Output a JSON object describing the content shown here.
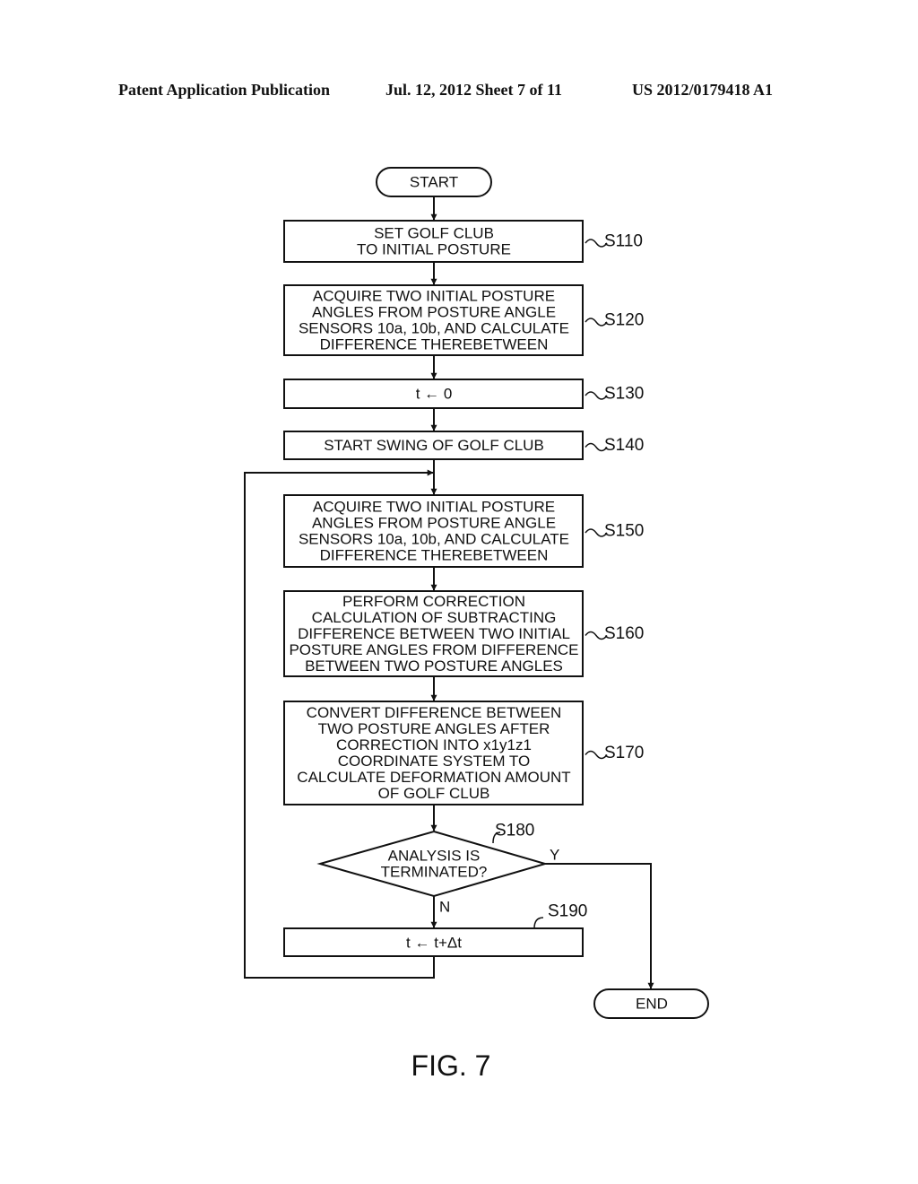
{
  "header": {
    "left": "Patent Application Publication",
    "date_sheet": "Jul. 12, 2012   Sheet 7 of 11",
    "number": "US 2012/0179418 A1"
  },
  "flowchart": {
    "start": "START",
    "end": "END",
    "steps": [
      {
        "id": "S110",
        "lines": [
          "SET GOLF CLUB",
          "TO INITIAL POSTURE"
        ]
      },
      {
        "id": "S120",
        "lines": [
          "ACQUIRE TWO INITIAL POSTURE",
          "ANGLES FROM POSTURE ANGLE",
          "SENSORS 10a, 10b, AND CALCULATE",
          "DIFFERENCE THEREBETWEEN"
        ]
      },
      {
        "id": "S130",
        "lines": [
          "t ← 0"
        ]
      },
      {
        "id": "S140",
        "lines": [
          "START SWING OF GOLF CLUB"
        ]
      },
      {
        "id": "S150",
        "lines": [
          "ACQUIRE TWO INITIAL POSTURE",
          "ANGLES FROM POSTURE ANGLE",
          "SENSORS 10a, 10b, AND CALCULATE",
          "DIFFERENCE THEREBETWEEN"
        ]
      },
      {
        "id": "S160",
        "lines": [
          "PERFORM CORRECTION",
          "CALCULATION OF SUBTRACTING",
          "DIFFERENCE BETWEEN TWO INITIAL",
          "POSTURE ANGLES FROM DIFFERENCE",
          "BETWEEN TWO POSTURE ANGLES"
        ]
      },
      {
        "id": "S170",
        "lines": [
          "CONVERT DIFFERENCE BETWEEN",
          "TWO POSTURE ANGLES AFTER",
          "CORRECTION INTO x1y1z1",
          "COORDINATE SYSTEM TO",
          "CALCULATE DEFORMATION AMOUNT",
          "OF GOLF CLUB"
        ]
      }
    ],
    "decision": {
      "id": "S180",
      "lines": [
        "ANALYSIS IS",
        "TERMINATED?"
      ],
      "yes_label": "Y",
      "no_label": "N"
    },
    "increment": {
      "id": "S190",
      "lines": [
        "t ← t+Δt"
      ]
    }
  },
  "figure_caption": "FIG. 7"
}
